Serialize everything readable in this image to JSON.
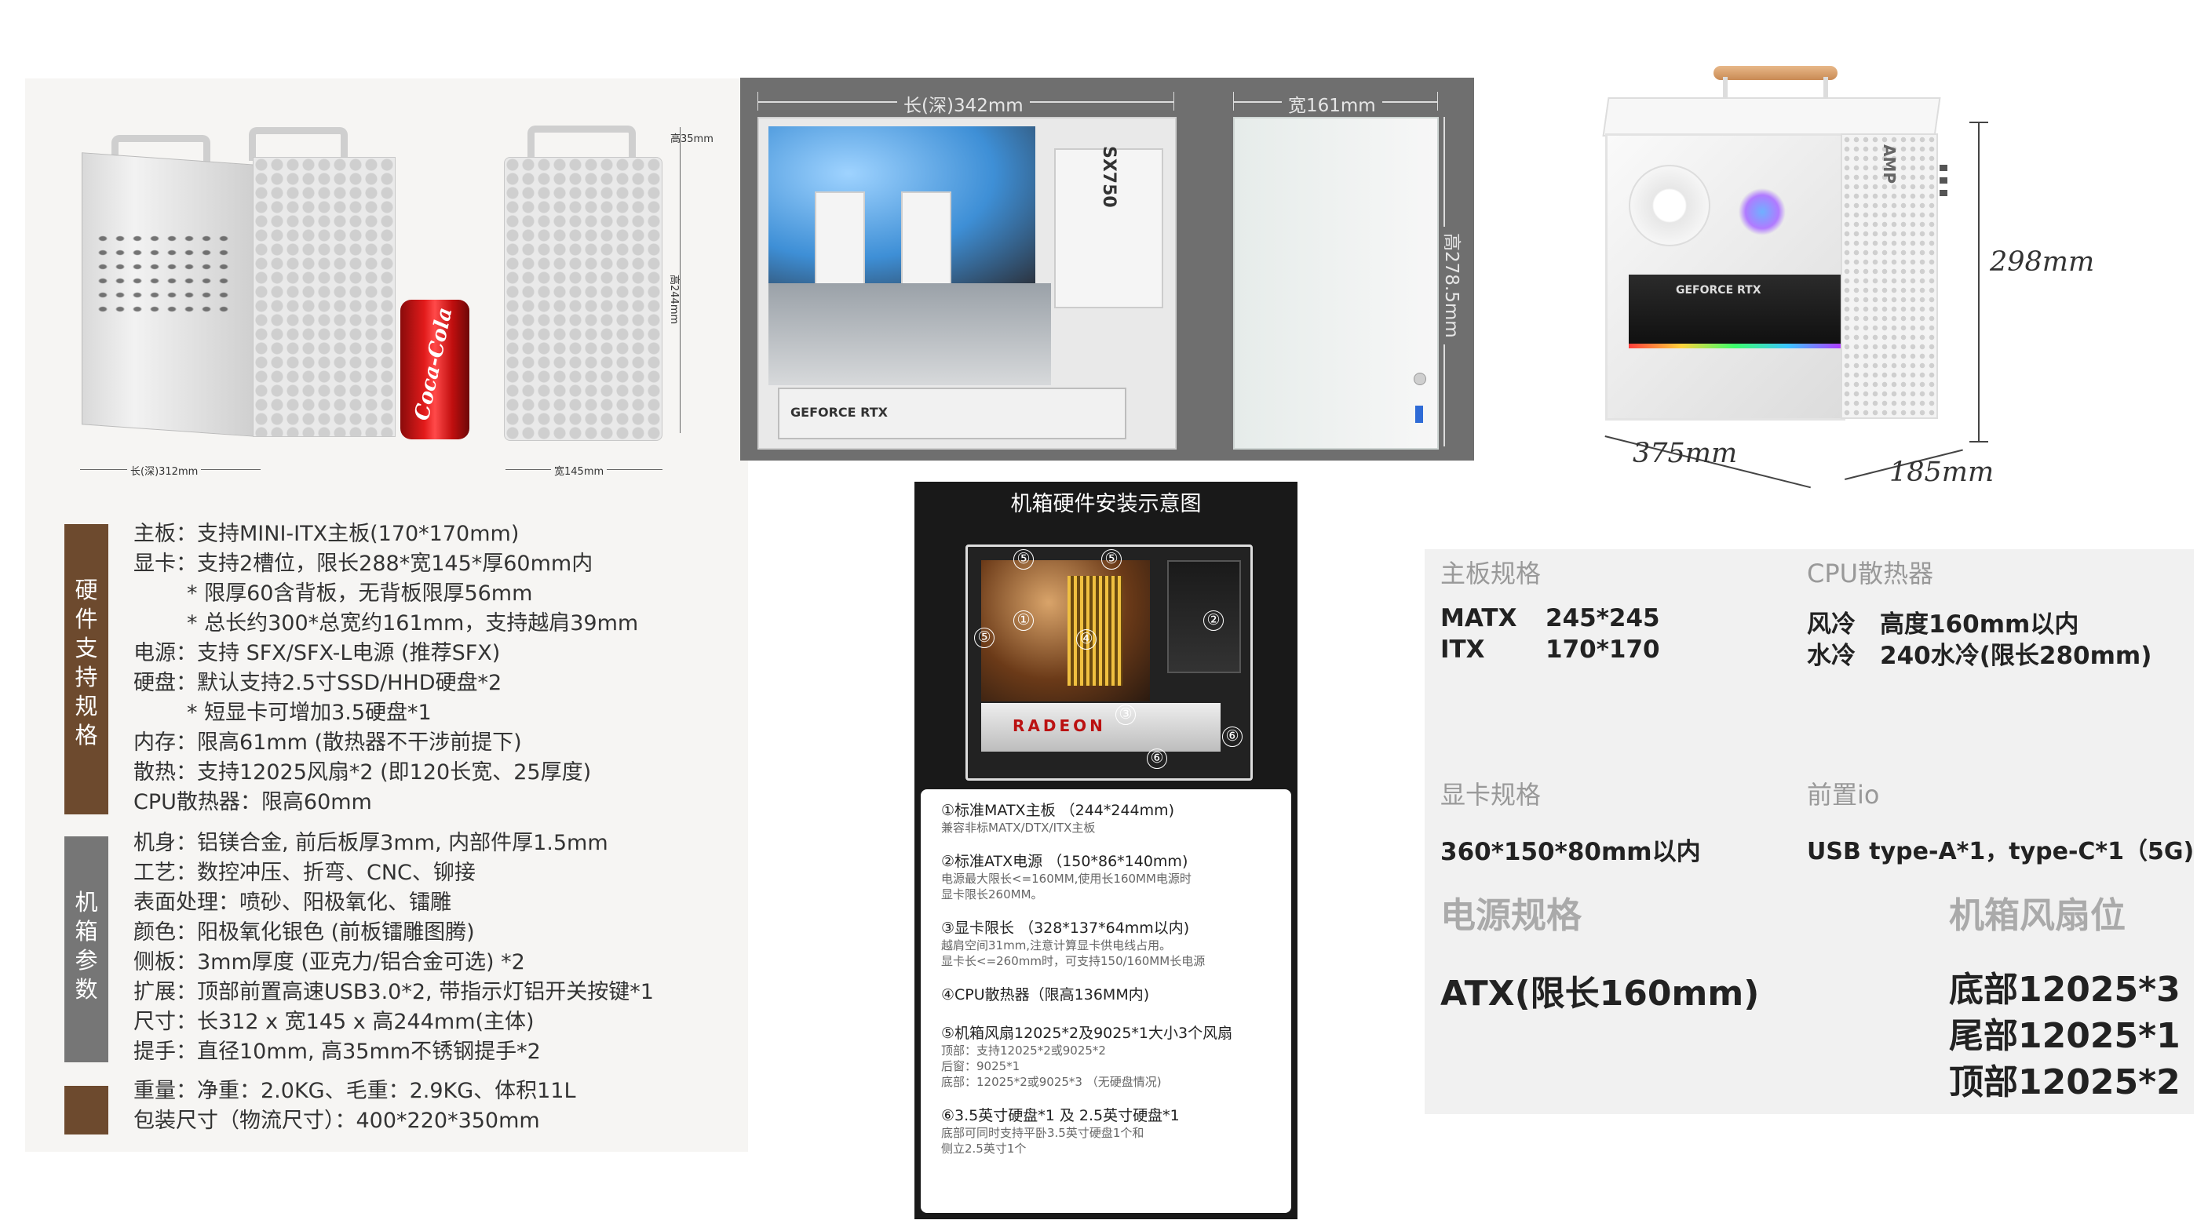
{
  "panel_dimensions": {
    "height_top": "高35mm",
    "height_main": "高244mm",
    "length_depth": "长(深)312mm",
    "width": "宽145mm",
    "can_logo": "Coca-Cola"
  },
  "hardware_support": {
    "sidebar": [
      "硬",
      "件",
      "支",
      "持",
      "规",
      "格"
    ],
    "lines": [
      "主板：支持MINI-ITX主板(170*170mm)",
      "显卡：支持2槽位，限长288*宽145*厚60mm内",
      "* 限厚60含背板，无背板限厚56mm",
      "* 总长约300*总宽约161mm，支持越肩39mm",
      "电源：支持 SFX/SFX-L电源 (推荐SFX)",
      "硬盘：默认支持2.5寸SSD/HHD硬盘*2",
      "* 短显卡可增加3.5硬盘*1",
      "内存：限高61mm (散热器不干涉前提下)",
      "散热：支持12025风扇*2 (即120长宽、25厚度)",
      "CPU散热器：限高60mm"
    ]
  },
  "chassis_params": {
    "sidebar": [
      "机",
      "箱",
      "参",
      "数"
    ],
    "lines": [
      "机身：铝镁合金, 前后板厚3mm, 内部件厚1.5mm",
      "工艺：数控冲压、折弯、CNC、铆接",
      "表面处理：喷砂、阳极氧化、镭雕",
      "颜色：阳极氧化银色 (前板镭雕图腾)",
      "侧板：3mm厚度 (亚克力/铝合金可选) *2",
      "扩展：顶部前置高速USB3.0*2, 带指示灯铝开关按键*1",
      "尺寸：长312 x 宽145 x 高244mm(主体)",
      "提手：直径10mm, 高35mm不锈钢提手*2"
    ]
  },
  "weight": {
    "lines": [
      "重量：净重：2.0KG、毛重：2.9KG、体积11L",
      "包装尺寸（物流尺寸）：400*220*350mm"
    ]
  },
  "photo_panel": {
    "length": "长(深)342mm",
    "width": "宽161mm",
    "height": "高278.5mm",
    "gpu_label": "GEFORCE RTX",
    "psu_label": "SX750"
  },
  "white_case": {
    "height": "298mm",
    "length": "375mm",
    "width": "185mm",
    "gpu_label": "GEFORCE RTX",
    "amp_label": "AMP"
  },
  "install_diagram": {
    "title": "机箱硬件安装示意图",
    "radeon": "RADEON",
    "markers": [
      "①",
      "②",
      "③",
      "④",
      "⑤",
      "⑥"
    ],
    "items": [
      {
        "head": "①标准MATX主板 （244*244mm)",
        "sub": [
          "兼容非标MATX/DTX/ITX主板"
        ]
      },
      {
        "head": "②标准ATX电源 （150*86*140mm)",
        "sub": [
          "电源最大限长<=160MM,使用长160MM电源时",
          "显卡限长260MM。"
        ]
      },
      {
        "head": "③显卡限长 （328*137*64mm以内)",
        "sub": [
          "越肩空间31mm,注意计算显卡供电线占用。",
          "显卡长<=260mm时，可支持150/160MM长电源"
        ]
      },
      {
        "head": "④CPU散热器（限高136MM内)",
        "sub": []
      },
      {
        "head": "⑤机箱风扇12025*2及9025*1大小3个风扇",
        "sub": [
          "顶部：支持12025*2或9025*2",
          "后窗：9025*1",
          "底部：12025*2或9025*3 （无硬盘情况)"
        ]
      },
      {
        "head": "⑥3.5英寸硬盘*1 及 2.5英寸硬盘*1",
        "sub": [
          "底部可同时支持平卧3.5英寸硬盘1个和",
          "侧立2.5英寸1个"
        ]
      }
    ]
  },
  "spec_table": {
    "mb_title": "主板规格",
    "mb_rows": [
      [
        "MATX",
        "245*245"
      ],
      [
        "ITX",
        "170*170"
      ]
    ],
    "cpu_title": "CPU散热器",
    "cpu_rows": [
      [
        "风冷",
        "高度160mm以内"
      ],
      [
        "水冷",
        "240水冷(限长280mm)"
      ]
    ],
    "gpu_title": "显卡规格",
    "gpu_value": "360*150*80mm以内",
    "io_title": "前置io",
    "io_value": "USB type-A*1，type-C*1（5G)",
    "psu_title": "电源规格",
    "psu_value": "ATX(限长160mm)",
    "fan_title": "机箱风扇位",
    "fan_values": [
      "底部12025*3",
      "尾部12025*1",
      "顶部12025*2"
    ]
  }
}
